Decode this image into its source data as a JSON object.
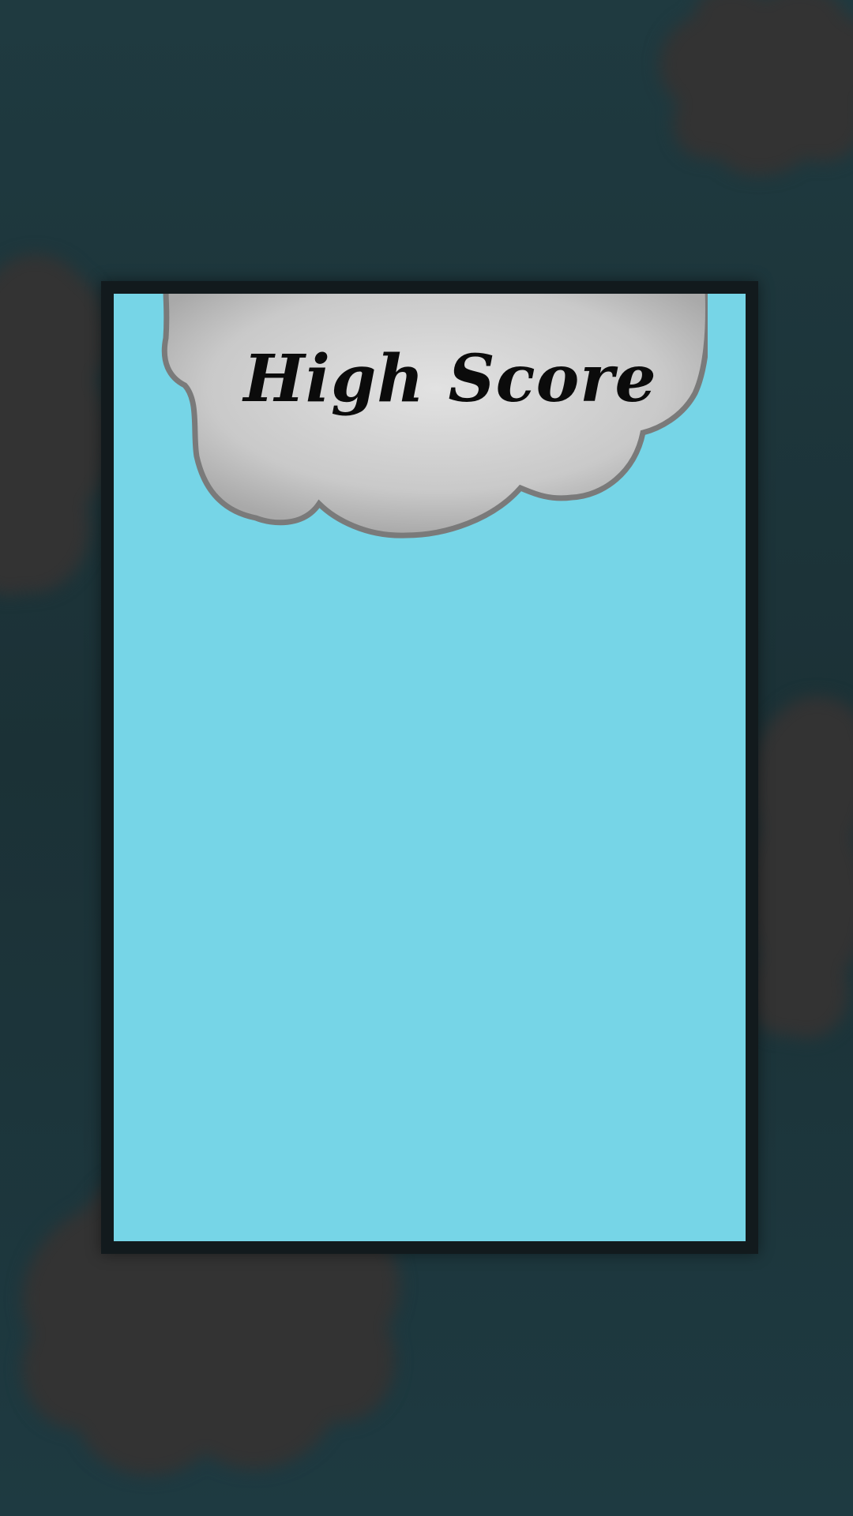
{
  "title": "High Score",
  "colors": {
    "background": "#1e3a41",
    "background_cloud": "#333333",
    "frame": "#121a1d",
    "panel": "#76d5e7",
    "title_cloud": "#cfcfcf",
    "title_text": "#0b0b0b"
  },
  "icons": {
    "title_cloud": "cloud-icon",
    "background_clouds": "cloud-icon"
  }
}
